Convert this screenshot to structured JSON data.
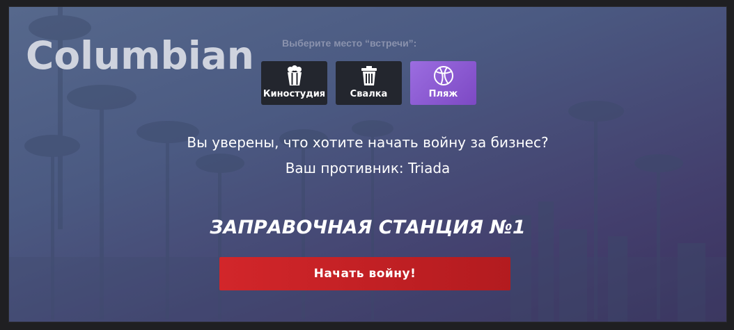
{
  "dialog": {
    "gang_name": "Columbian",
    "location_prompt": "Выберите место “встречи”:",
    "locations": [
      {
        "label": "Киностудия",
        "icon": "popcorn-icon",
        "selected": false
      },
      {
        "label": "Свалка",
        "icon": "trash-can-icon",
        "selected": false
      },
      {
        "label": "Пляж",
        "icon": "beach-ball-icon",
        "selected": true
      }
    ],
    "question": "Вы уверены, что хотите начать войну за бизнес?",
    "opponent": "Ваш противник: Triada",
    "business_name": "ЗАПРАВОЧНАЯ СТАНЦИЯ №1",
    "start_button": "Начать войну!"
  },
  "colors": {
    "accent_purple": "#8c5ad6",
    "button_red": "#c92226",
    "button_dark": "#23262e"
  }
}
